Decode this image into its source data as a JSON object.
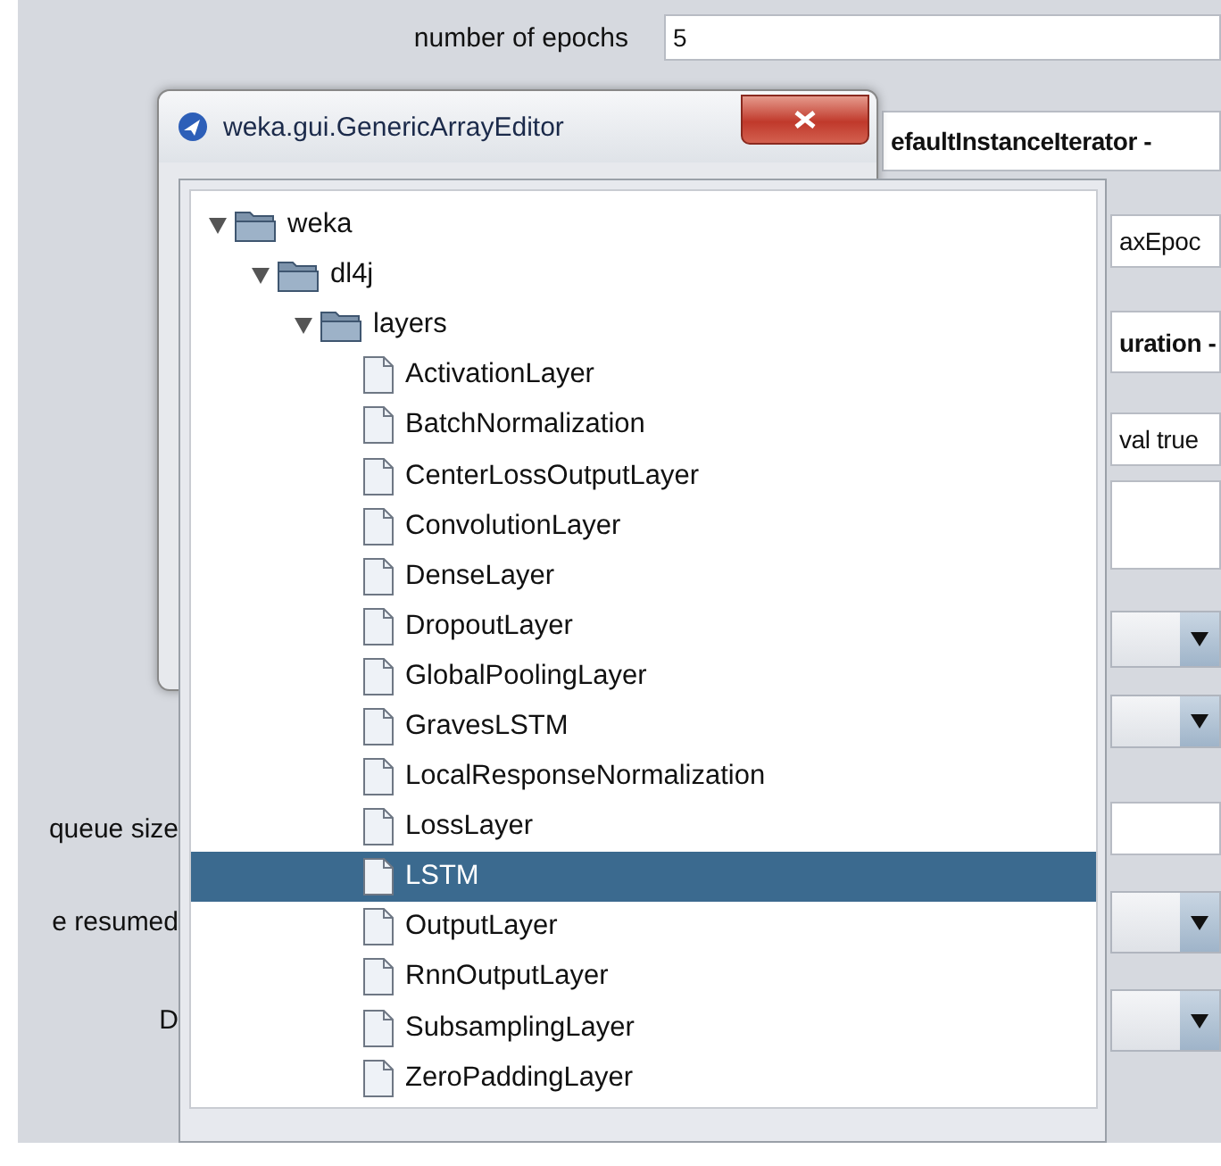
{
  "background_form": {
    "rows": [
      {
        "kind": "text",
        "label": "number of epochs",
        "value": "5"
      },
      {
        "kind": "bold",
        "value": "efaultInstanceIterator -"
      },
      {
        "kind": "text",
        "value": "axEpoc"
      },
      {
        "kind": "bold",
        "value": "uration -"
      },
      {
        "kind": "text",
        "value": "val true"
      },
      {
        "kind": "text"
      },
      {
        "kind": "dropdown"
      },
      {
        "kind": "dropdown"
      },
      {
        "kind": "text",
        "label": "queue size"
      },
      {
        "kind": "dropdown",
        "label": "e resumed"
      },
      {
        "kind": "dropdown",
        "label": "D"
      }
    ]
  },
  "dialog": {
    "title": "weka.gui.GenericArrayEditor"
  },
  "tree": [
    {
      "label": "weka",
      "kind": "folder",
      "expanded": true,
      "selected": false,
      "children": [
        {
          "label": "dl4j",
          "kind": "folder",
          "expanded": true,
          "selected": false,
          "children": [
            {
              "label": "layers",
              "kind": "folder",
              "expanded": true,
              "selected": false,
              "children": [
                {
                  "label": "ActivationLayer",
                  "kind": "leaf",
                  "selected": false
                },
                {
                  "label": "BatchNormalization",
                  "kind": "leaf",
                  "selected": false
                },
                {
                  "label": "CenterLossOutputLayer",
                  "kind": "leaf",
                  "selected": false
                },
                {
                  "label": "ConvolutionLayer",
                  "kind": "leaf",
                  "selected": false
                },
                {
                  "label": "DenseLayer",
                  "kind": "leaf",
                  "selected": false
                },
                {
                  "label": "DropoutLayer",
                  "kind": "leaf",
                  "selected": false
                },
                {
                  "label": "GlobalPoolingLayer",
                  "kind": "leaf",
                  "selected": false
                },
                {
                  "label": "GravesLSTM",
                  "kind": "leaf",
                  "selected": false
                },
                {
                  "label": "LocalResponseNormalization",
                  "kind": "leaf",
                  "selected": false
                },
                {
                  "label": "LossLayer",
                  "kind": "leaf",
                  "selected": false
                },
                {
                  "label": "LSTM",
                  "kind": "leaf",
                  "selected": true
                },
                {
                  "label": "OutputLayer",
                  "kind": "leaf",
                  "selected": false
                },
                {
                  "label": "RnnOutputLayer",
                  "kind": "leaf",
                  "selected": false
                },
                {
                  "label": "SubsamplingLayer",
                  "kind": "leaf",
                  "selected": false
                },
                {
                  "label": "ZeroPaddingLayer",
                  "kind": "leaf",
                  "selected": false
                }
              ]
            }
          ]
        }
      ]
    }
  ]
}
